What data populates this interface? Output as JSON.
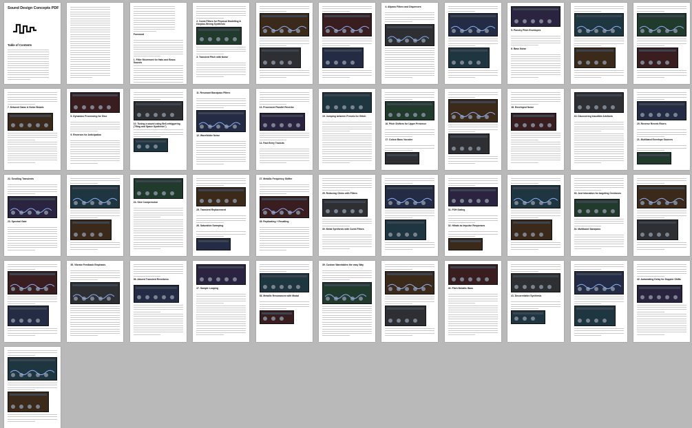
{
  "document": {
    "title": "Sound Design Concepts PDF",
    "toc_heading": "Table of Contents"
  },
  "pages": [
    {
      "headings": []
    },
    {
      "headings": []
    },
    {
      "headings": [
        "Foreword",
        "1. Filter Movement for Hats and Brass Sounds"
      ]
    },
    {
      "headings": [
        "2. Comb Filters for Physical Modelling & Karplus-Strong Synthesis",
        "3. Transient Pitch with Noise"
      ]
    },
    {
      "headings": []
    },
    {
      "headings": []
    },
    {
      "headings": [
        "4. Allpass Filters and Dispersers"
      ]
    },
    {
      "headings": []
    },
    {
      "headings": [
        "5. Punchy Pitch Envelopes",
        "6. Bass Noise"
      ]
    },
    {
      "headings": []
    },
    {
      "headings": []
    },
    {
      "headings": [
        "7. Detuned Saws & Noise Beasts"
      ]
    },
    {
      "headings": [
        "8. Dynamics Processing for Glue",
        "9. Reverses for Anticipation"
      ]
    },
    {
      "headings": [
        "10. Tuning a sound using Bell-retriggering (\"Ring and Space Synthesis\")"
      ]
    },
    {
      "headings": [
        "11. Resonant Bandpass Filters",
        "12. Wavefolder Noise"
      ]
    },
    {
      "headings": [
        "13. Processed Parallel Reverbs",
        "14. Fast Entry Transits"
      ]
    },
    {
      "headings": [
        "15. Jumping between Presets for Glitch"
      ]
    },
    {
      "headings": [
        "16. Pitch Shifters for Upper Presence",
        "17. Colour Bass Vocoder"
      ]
    },
    {
      "headings": []
    },
    {
      "headings": [
        "18. Enveloped Noise"
      ]
    },
    {
      "headings": [
        "19. Discovering Inaudible Artefacts"
      ]
    },
    {
      "headings": [
        "20. Reverse Reverb Risers",
        "21. Multiband Envelope Sources"
      ]
    },
    {
      "headings": [
        "22. Scrolling Transients",
        "23. Spectral Gate"
      ]
    },
    {
      "headings": []
    },
    {
      "headings": [
        "24. Sine Compression"
      ]
    },
    {
      "headings": [
        "25. Transient Replacement",
        "26. Saturation Sweeping"
      ]
    },
    {
      "headings": [
        "27. Metallic Frequency Shifter",
        "28. Replicating + Recalling"
      ]
    },
    {
      "headings": [
        "29. Reducing Clicks with Filters",
        "30. Metal Synthesis with Comb Filters"
      ]
    },
    {
      "headings": []
    },
    {
      "headings": [
        "31. FOH Gating",
        "32. Hihats as Impulse Responses"
      ]
    },
    {
      "headings": []
    },
    {
      "headings": [
        "33. Just Intonation for targeting Overtones",
        "34. Multiband Sandpass"
      ]
    },
    {
      "headings": []
    },
    {
      "headings": []
    },
    {
      "headings": [
        "35. Vibrato Feedback Emphasis"
      ]
    },
    {
      "headings": [
        "36. Absent Transient Reverbess"
      ]
    },
    {
      "headings": [
        "37. Sample Looping"
      ]
    },
    {
      "headings": [
        "38. Metallic Resonances with Modal"
      ]
    },
    {
      "headings": [
        "39. Custom Wavetables the easy Way"
      ]
    },
    {
      "headings": []
    },
    {
      "headings": [
        "40. Pitch Metallic Bass"
      ]
    },
    {
      "headings": [
        "41. Decorrelative Synthesis"
      ]
    },
    {
      "headings": []
    },
    {
      "headings": [
        "42. Automating Delay for Doppler Shifts"
      ]
    },
    {
      "headings": []
    }
  ]
}
